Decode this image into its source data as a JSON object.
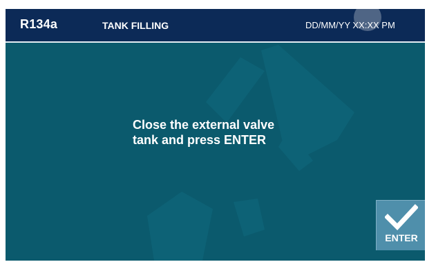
{
  "header": {
    "gas": "R134a",
    "title": "TANK FILLING",
    "datetime": "DD/MM/YY XX:XX PM"
  },
  "message": {
    "line1": "Close the external valve",
    "line2": "tank and press ENTER"
  },
  "enter_button": {
    "label": "ENTER",
    "icon": "checkmark-icon"
  },
  "colors": {
    "header_bg": "#0c2a57",
    "screen_bg": "#0b5a6d",
    "button_bg": "#4f8fab"
  }
}
